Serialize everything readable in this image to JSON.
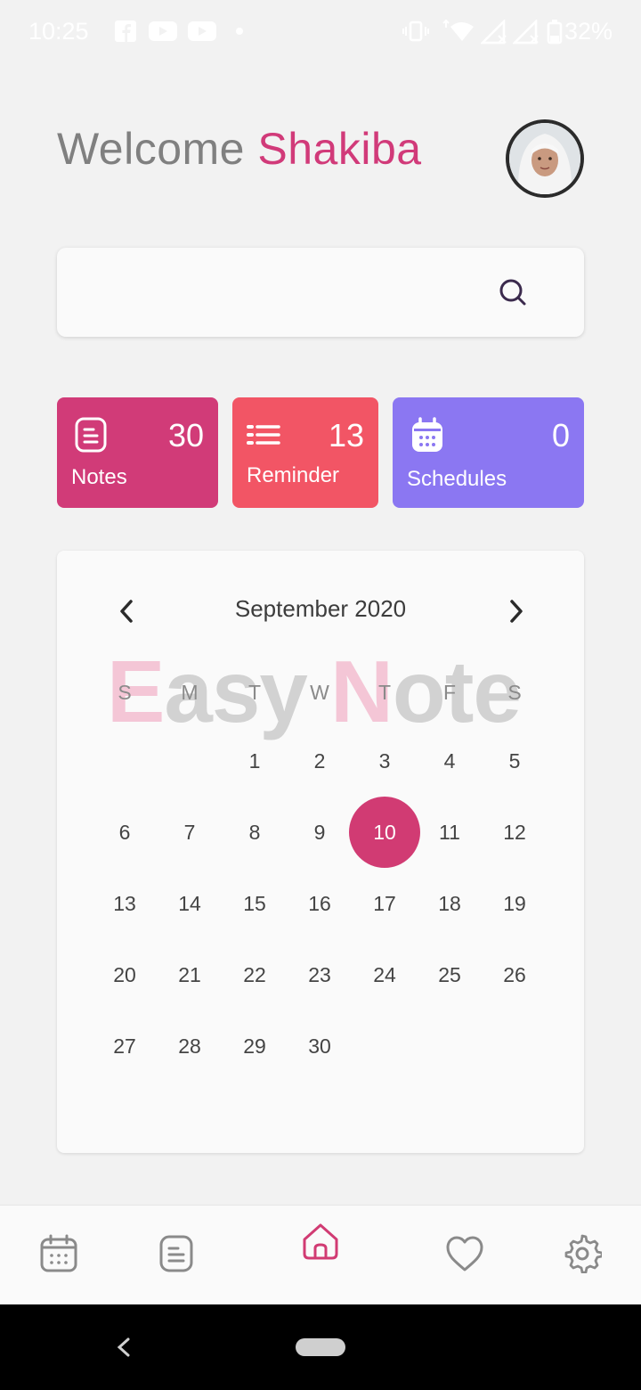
{
  "status_bar": {
    "time": "10:25",
    "battery": "32%",
    "icons": [
      "facebook-icon",
      "youtube-icon",
      "youtube-icon",
      "dot-icon",
      "vibrate-icon",
      "wifi-icon",
      "signal-icon",
      "signal-icon",
      "battery-icon"
    ]
  },
  "header": {
    "welcome_prefix": "Welcome",
    "user_name": "Shakiba"
  },
  "search": {
    "placeholder": ""
  },
  "stats": {
    "notes": {
      "label": "Notes",
      "count": "30",
      "color": "#d13b78"
    },
    "reminder": {
      "label": "Reminder",
      "count": "13",
      "color": "#f25565"
    },
    "schedules": {
      "label": "Schedules",
      "count": "0",
      "color": "#8b77f2"
    }
  },
  "calendar": {
    "month": "September 2020",
    "watermark_a": "E",
    "watermark_b": "asy ",
    "watermark_c": "N",
    "watermark_d": "ote",
    "weekdays": [
      "S",
      "M",
      "T",
      "W",
      "T",
      "F",
      "S"
    ],
    "first_weekday_index": 2,
    "days_in_month": 30,
    "selected_day": "10",
    "selected_color": "#d13b73"
  },
  "bottom_nav": {
    "items": [
      "calendar-icon",
      "notes-icon",
      "home-icon",
      "heart-icon",
      "settings-icon"
    ],
    "active": "home-icon",
    "active_color": "#d13b73"
  }
}
